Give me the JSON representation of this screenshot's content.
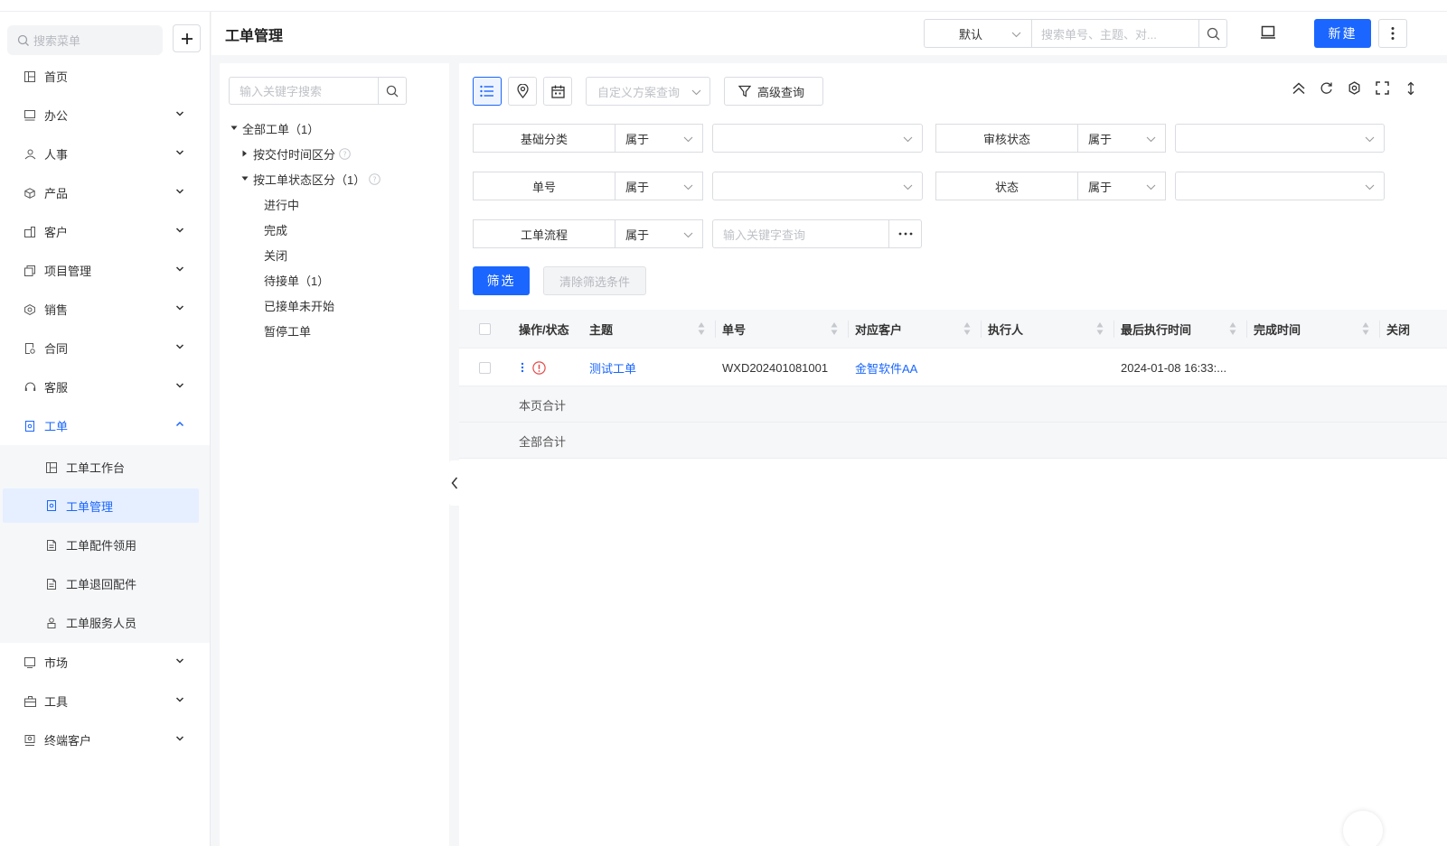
{
  "sidebar": {
    "search_placeholder": "搜索菜单",
    "menu": [
      {
        "label": "首页",
        "icon": "home-grid-icon",
        "has_children": false
      },
      {
        "label": "办公",
        "icon": "office-icon",
        "has_children": true
      },
      {
        "label": "人事",
        "icon": "hr-icon",
        "has_children": true
      },
      {
        "label": "产品",
        "icon": "product-cube-icon",
        "has_children": true
      },
      {
        "label": "客户",
        "icon": "customer-icon",
        "has_children": true
      },
      {
        "label": "项目管理",
        "icon": "project-icon",
        "has_children": true
      },
      {
        "label": "销售",
        "icon": "sales-icon",
        "has_children": true
      },
      {
        "label": "合同",
        "icon": "contract-icon",
        "has_children": true
      },
      {
        "label": "客服",
        "icon": "headset-icon",
        "has_children": true
      },
      {
        "label": "工单",
        "icon": "workorder-icon",
        "has_children": true,
        "expanded": true
      }
    ],
    "submenu": [
      {
        "label": "工单工作台",
        "icon": "dashboard-icon"
      },
      {
        "label": "工单管理",
        "icon": "workorder-doc-icon",
        "selected": true
      },
      {
        "label": "工单配件领用",
        "icon": "parts-doc-icon"
      },
      {
        "label": "工单退回配件",
        "icon": "return-doc-icon"
      },
      {
        "label": "工单服务人员",
        "icon": "staff-icon"
      }
    ],
    "menu_after": [
      {
        "label": "市场",
        "icon": "market-icon",
        "has_children": true
      },
      {
        "label": "工具",
        "icon": "toolbox-icon",
        "has_children": true
      },
      {
        "label": "终端客户",
        "icon": "end-customer-icon",
        "has_children": true
      }
    ]
  },
  "header": {
    "title": "工单管理",
    "view_select": "默认",
    "search_placeholder": "搜索单号、主题、对...",
    "new_button": "新建"
  },
  "tree": {
    "search_placeholder": "输入关键字搜索",
    "root": "全部工单（1）",
    "group1": "按交付时间区分",
    "group2": "按工单状态区分（1）",
    "children": [
      "进行中",
      "完成",
      "关闭",
      "待接单（1）",
      "已接单未开始",
      "暂停工单"
    ]
  },
  "toolbar": {
    "scheme_placeholder": "自定义方案查询",
    "advanced_query": "高级查询"
  },
  "filters": {
    "row1": {
      "label_a": "基础分类",
      "op_a": "属于",
      "label_b": "审核状态",
      "op_b": "属于"
    },
    "row2": {
      "label_a": "单号",
      "op_a": "属于",
      "label_b": "状态",
      "op_b": "属于"
    },
    "row3": {
      "label_a": "工单流程",
      "op_a": "属于",
      "keyword_placeholder": "输入关键字查询"
    },
    "filter_button": "筛选",
    "clear_button": "清除筛选条件"
  },
  "table": {
    "headers": [
      "操作/状态",
      "主题",
      "单号",
      "对应客户",
      "执行人",
      "最后执行时间",
      "完成时间",
      "关闭"
    ],
    "rows": [
      {
        "subject": "测试工单",
        "number": "WXD202401081001",
        "customer": "金智软件AA",
        "executor": "",
        "last_exec": "2024-01-08 16:33:...",
        "done_time": ""
      }
    ],
    "page_total": "本页合计",
    "all_total": "全部合计"
  },
  "colors": {
    "accent": "#1a66ff",
    "warning": "#e84a4a"
  }
}
